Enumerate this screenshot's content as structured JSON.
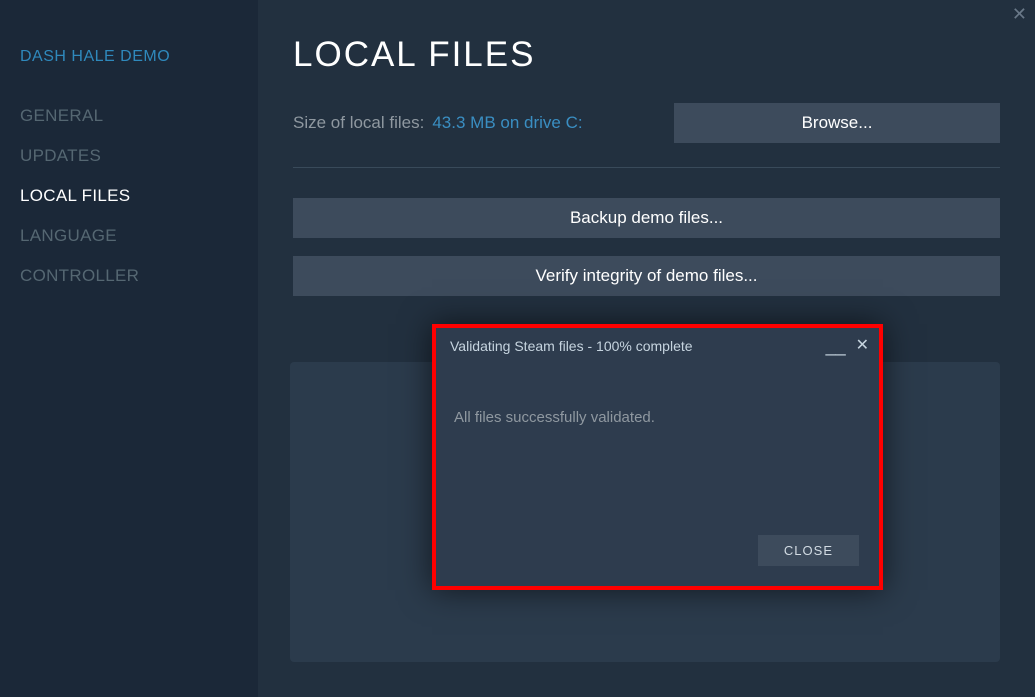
{
  "sidebar": {
    "title": "DASH HALE DEMO",
    "items": [
      {
        "label": "GENERAL",
        "active": false
      },
      {
        "label": "UPDATES",
        "active": false
      },
      {
        "label": "LOCAL FILES",
        "active": true
      },
      {
        "label": "LANGUAGE",
        "active": false
      },
      {
        "label": "CONTROLLER",
        "active": false
      }
    ]
  },
  "main": {
    "title": "LOCAL FILES",
    "size_label": "Size of local files:",
    "size_value": "43.3 MB on drive C:",
    "browse_label": "Browse...",
    "backup_label": "Backup demo files...",
    "verify_label": "Verify integrity of demo files..."
  },
  "dialog": {
    "title": "Validating Steam files - 100% complete",
    "message": "All files successfully validated.",
    "close_label": "CLOSE"
  },
  "window": {
    "close_glyph": "✕"
  }
}
